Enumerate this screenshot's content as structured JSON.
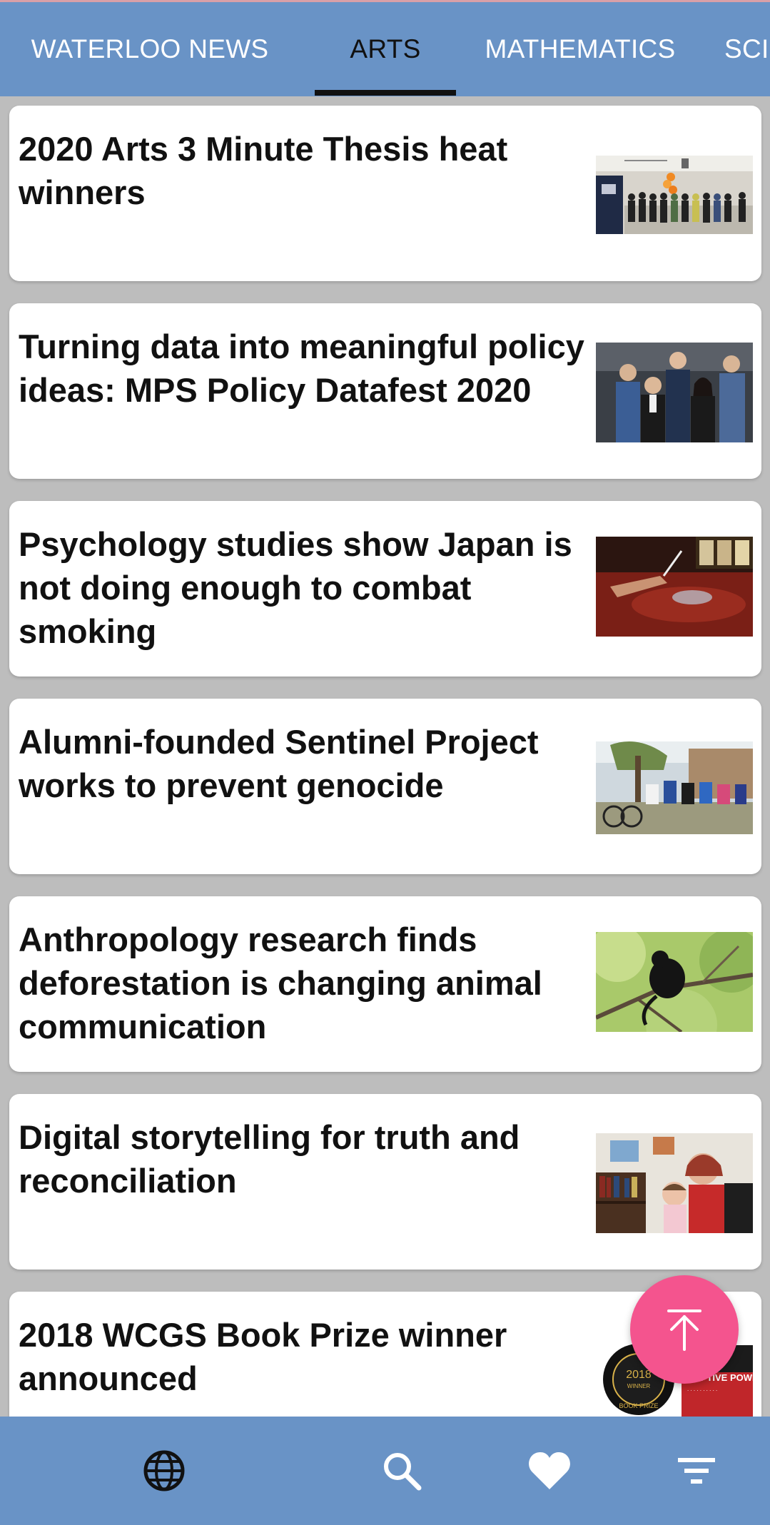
{
  "tabs": [
    {
      "label": "WATERLOO NEWS",
      "active": false
    },
    {
      "label": "ARTS",
      "active": true
    },
    {
      "label": "MATHEMATICS",
      "active": false
    },
    {
      "label": "SCI",
      "active": false
    }
  ],
  "articles": [
    {
      "title": "2020 Arts 3 Minute Thesis heat winners",
      "thumbnail": "group-photo-event"
    },
    {
      "title": "Turning data into meaningful policy ideas: MPS Policy Datafest 2020",
      "thumbnail": "group-photo-formal"
    },
    {
      "title": "Psychology studies show Japan is not doing enough to combat smoking",
      "thumbnail": "ashtray-bar"
    },
    {
      "title": "Alumni-founded Sentinel Project works to prevent genocide",
      "thumbnail": "village-meeting"
    },
    {
      "title": "Anthropology research finds deforestation is changing animal communication",
      "thumbnail": "monkey-in-tree"
    },
    {
      "title": "Digital storytelling for truth and reconciliation",
      "thumbnail": "mother-and-child"
    },
    {
      "title": "2018 WCGS Book Prize winner announced",
      "thumbnail": "book-prize-seal",
      "seal_text": "2018",
      "seal_subtext": "WINNER",
      "seal_ring_text": "BOOK PRIZE",
      "book_title": "RUPTIVE POWER"
    }
  ],
  "fab": {
    "icon": "arrow-up-icon"
  },
  "bottom_nav": [
    {
      "name": "globe",
      "icon": "globe-icon",
      "active": true
    },
    {
      "name": "search",
      "icon": "search-icon",
      "active": false
    },
    {
      "name": "favorites",
      "icon": "heart-icon",
      "active": false
    },
    {
      "name": "filter",
      "icon": "filter-icon",
      "active": false
    }
  ],
  "colors": {
    "bar": "#6993c6",
    "background": "#bdbdbd",
    "fab": "#f4548e",
    "active_tab_text": "#111111",
    "tab_text": "#ffffff"
  }
}
